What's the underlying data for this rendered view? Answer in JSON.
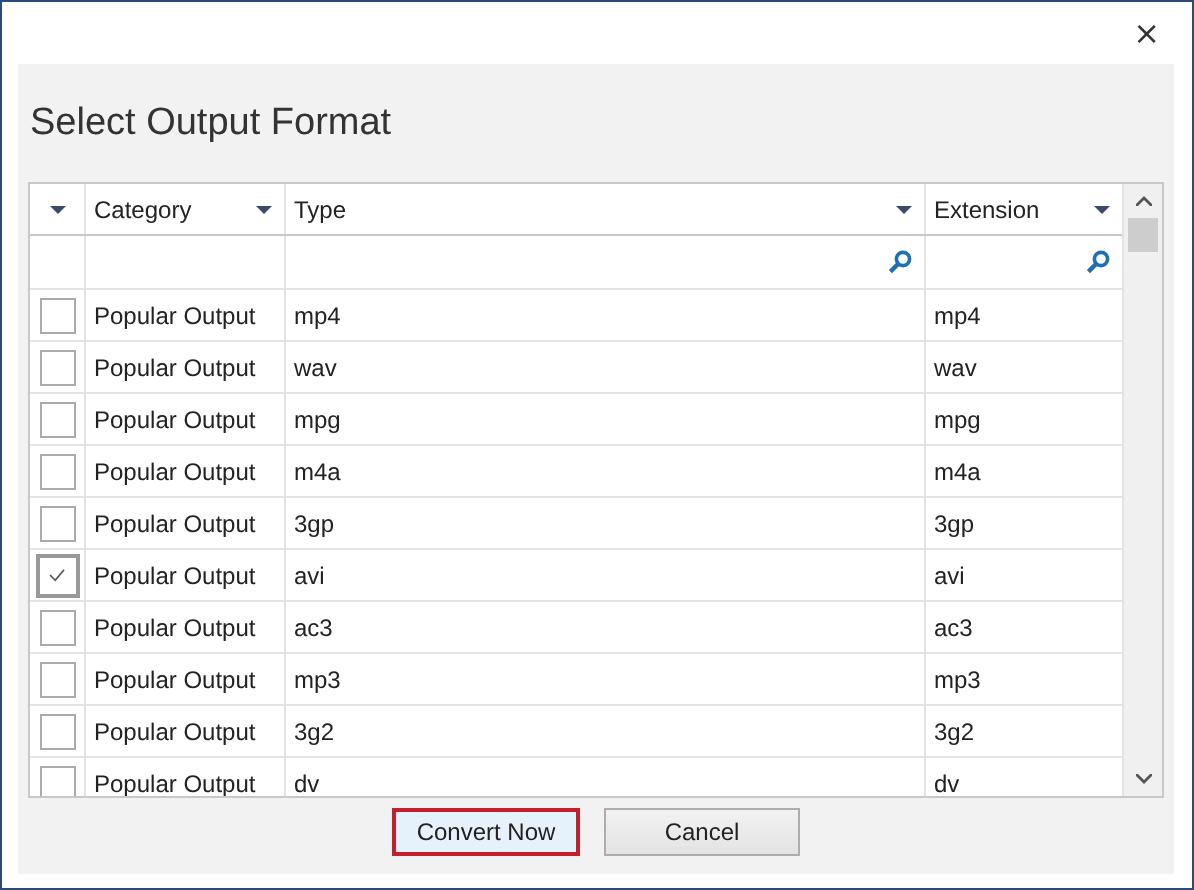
{
  "window": {
    "close": "×"
  },
  "heading": "Select Output Format",
  "table": {
    "columns": [
      {
        "label": "Category"
      },
      {
        "label": "Type"
      },
      {
        "label": "Extension"
      }
    ],
    "rows": [
      {
        "category": "Popular Output",
        "type": "mp4",
        "extension": "mp4",
        "checked": false
      },
      {
        "category": "Popular Output",
        "type": "wav",
        "extension": "wav",
        "checked": false
      },
      {
        "category": "Popular Output",
        "type": "mpg",
        "extension": "mpg",
        "checked": false
      },
      {
        "category": "Popular Output",
        "type": "m4a",
        "extension": "m4a",
        "checked": false
      },
      {
        "category": "Popular Output",
        "type": "3gp",
        "extension": "3gp",
        "checked": false
      },
      {
        "category": "Popular Output",
        "type": "avi",
        "extension": "avi",
        "checked": true
      },
      {
        "category": "Popular Output",
        "type": "ac3",
        "extension": "ac3",
        "checked": false
      },
      {
        "category": "Popular Output",
        "type": "mp3",
        "extension": "mp3",
        "checked": false
      },
      {
        "category": "Popular Output",
        "type": "3g2",
        "extension": "3g2",
        "checked": false
      },
      {
        "category": "Popular Output",
        "type": "dv",
        "extension": "dv",
        "checked": false
      }
    ]
  },
  "buttons": [
    {
      "label": "Convert Now",
      "focused": true
    },
    {
      "label": "Cancel",
      "focused": false
    }
  ]
}
